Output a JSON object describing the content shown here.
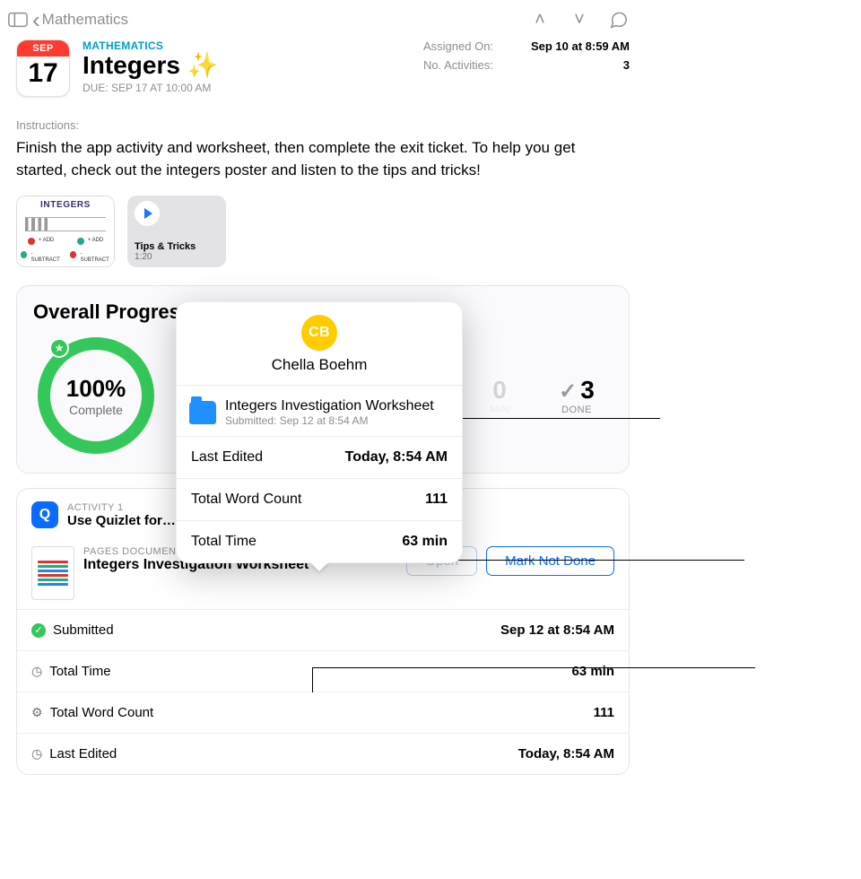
{
  "nav": {
    "back_label": "Mathematics"
  },
  "header": {
    "subject": "MATHEMATICS",
    "title": "Integers ✨",
    "due_line": "DUE: SEP 17 AT 10:00 AM",
    "cal_month": "SEP",
    "cal_day": "17",
    "assigned_label": "Assigned On:",
    "assigned_value": "Sep 10 at 8:59 AM",
    "activities_label": "No. Activities:",
    "activities_value": "3"
  },
  "instructions": {
    "label": "Instructions:",
    "body": "Finish the app activity and worksheet, then complete the exit ticket. To help you get started, check out the integers poster and listen to the tips and tricks!"
  },
  "tiles": {
    "poster_label": "INTEGERS",
    "poster_sub1": "+ ADD",
    "poster_sub2": "- SUBTRACT",
    "video_title": "Tips & Tricks",
    "video_duration": "1:20"
  },
  "progress": {
    "heading": "Overall Progress",
    "percent": "100%",
    "percent_label": "Complete",
    "stat_min_num": "0",
    "stat_min_cap": "MIN",
    "stat_done_num": "3",
    "stat_done_cap": "DONE"
  },
  "activity1": {
    "pre": "ACTIVITY 1",
    "title": "Use Quizlet for…"
  },
  "document": {
    "type_label": "PAGES DOCUMENT",
    "title": "Integers Investigation Worksheet",
    "open_label": "Open",
    "mark_label": "Mark Not Done",
    "rows": {
      "submitted_label": "Submitted",
      "submitted_value": "Sep 12 at 8:54 AM",
      "time_label": "Total Time",
      "time_value": "63 min",
      "words_label": "Total Word Count",
      "words_value": "111",
      "edited_label": "Last Edited",
      "edited_value": "Today, 8:54 AM"
    }
  },
  "popover": {
    "initials": "CB",
    "name": "Chella Boehm",
    "file_title": "Integers Investigation Worksheet",
    "file_sub": "Submitted: Sep 12 at 8:54 AM",
    "r1_label": "Last Edited",
    "r1_value": "Today, 8:54 AM",
    "r2_label": "Total Word Count",
    "r2_value": "111",
    "r3_label": "Total Time",
    "r3_value": "63 min"
  }
}
